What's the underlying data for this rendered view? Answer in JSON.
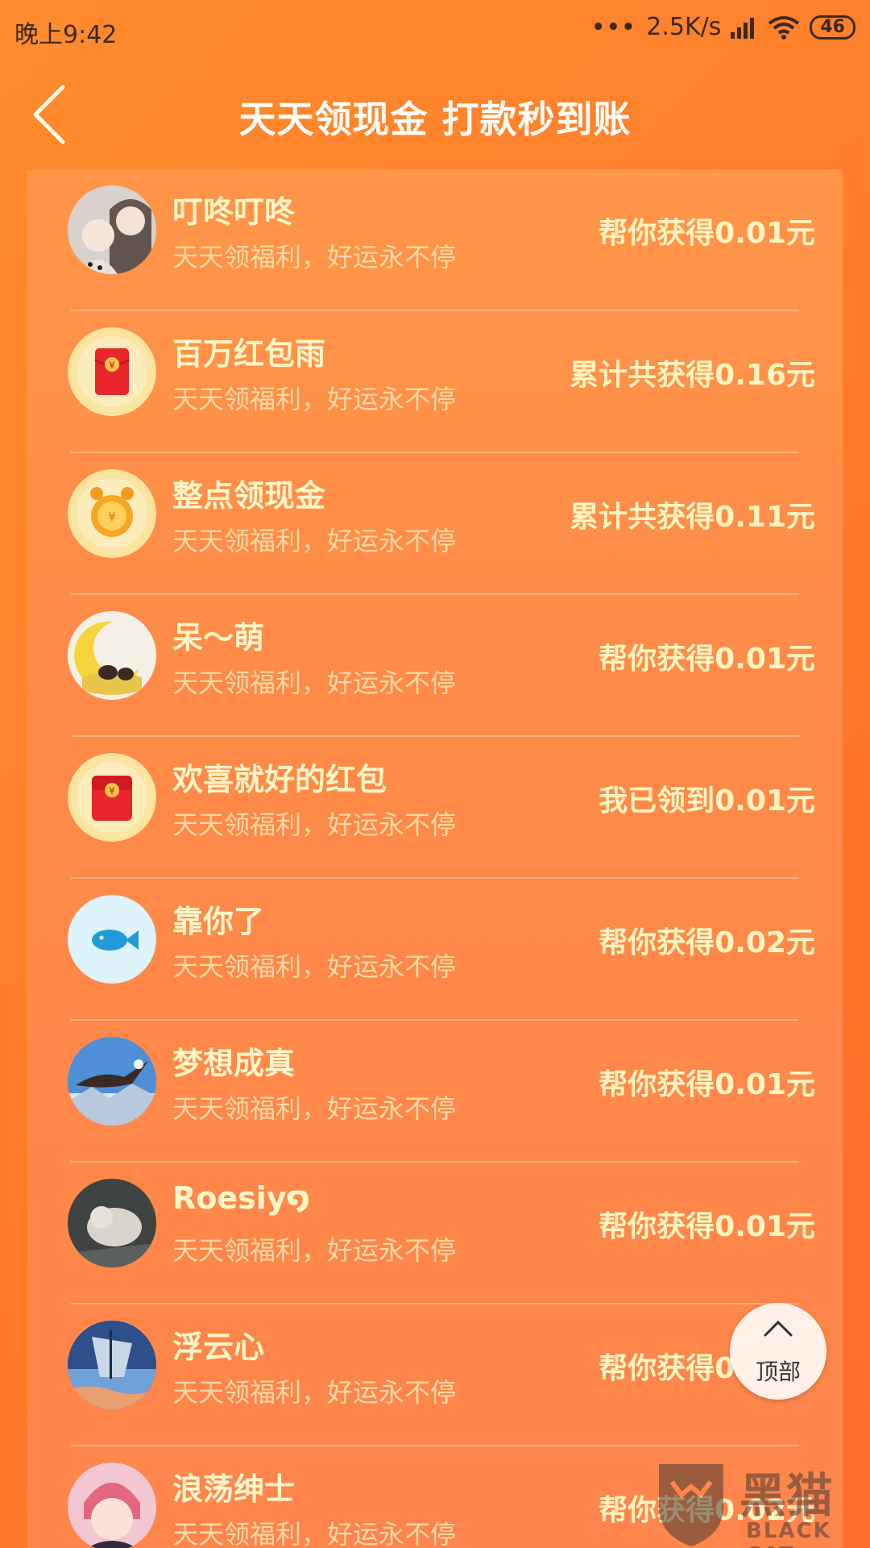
{
  "status": {
    "time": "晚上9:42",
    "net_speed": "2.5K/s",
    "battery": "46"
  },
  "header": {
    "title": "天天领现金 打款秒到账"
  },
  "list": [
    {
      "name": "叮咚叮咚",
      "subtitle": "天天领福利，好运永不停",
      "amount": "帮你获得0.01元",
      "avatar": "photo-avatar"
    },
    {
      "name": "百万红包雨",
      "subtitle": "天天领福利，好运永不停",
      "amount": "累计共获得0.16元",
      "avatar": "red-envelope-icon"
    },
    {
      "name": "整点领现金",
      "subtitle": "天天领福利，好运永不停",
      "amount": "累计共获得0.11元",
      "avatar": "alarm-clock-icon"
    },
    {
      "name": "呆～萌",
      "subtitle": "天天领福利，好运永不停",
      "amount": "帮你获得0.01元",
      "avatar": "photo-avatar"
    },
    {
      "name": "欢喜就好的红包",
      "subtitle": "天天领福利，好运永不停",
      "amount": "我已领到0.01元",
      "avatar": "red-envelope-icon"
    },
    {
      "name": "靠你了",
      "subtitle": "天天领福利，好运永不停",
      "amount": "帮你获得0.02元",
      "avatar": "fish-icon"
    },
    {
      "name": "梦想成真",
      "subtitle": "天天领福利，好运永不停",
      "amount": "帮你获得0.01元",
      "avatar": "photo-avatar"
    },
    {
      "name": "Roesiy໑",
      "subtitle": "天天领福利，好运永不停",
      "amount": "帮你获得0.01元",
      "avatar": "photo-avatar"
    },
    {
      "name": "浮云心",
      "subtitle": "天天领福利，好运永不停",
      "amount": "帮你获得0.01元",
      "avatar": "photo-avatar"
    },
    {
      "name": "浪荡绅士",
      "subtitle": "天天领福利，好运永不停",
      "amount": "帮你获得0.02元",
      "avatar": "photo-avatar"
    }
  ],
  "top_button": {
    "label": "顶部"
  },
  "watermark": {
    "title": "黑猫",
    "subtitle": "BLACK CAT"
  },
  "colors": {
    "background": "#ff7f2e",
    "name_text": "#fff6c8",
    "subtitle_text": "#ffd9a6",
    "amount_text": "#fff4c0"
  }
}
